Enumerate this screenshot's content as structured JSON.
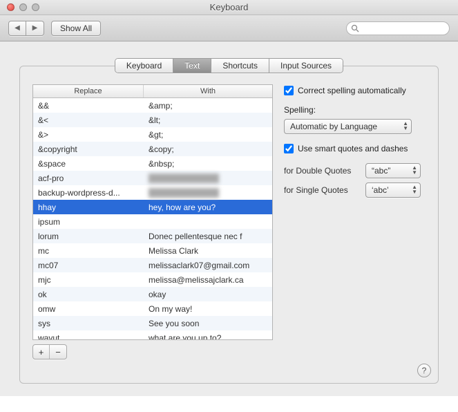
{
  "window": {
    "title": "Keyboard"
  },
  "toolbar": {
    "show_all": "Show All",
    "search_placeholder": ""
  },
  "tabs": {
    "items": [
      "Keyboard",
      "Text",
      "Shortcuts",
      "Input Sources"
    ],
    "active_index": 1
  },
  "table": {
    "header_replace": "Replace",
    "header_with": "With",
    "rows": [
      {
        "replace": "&&",
        "with": "&amp;"
      },
      {
        "replace": "&<",
        "with": "&lt;"
      },
      {
        "replace": "&>",
        "with": "&gt;"
      },
      {
        "replace": "&copyright",
        "with": "&copy;"
      },
      {
        "replace": "&space",
        "with": "&nbsp;"
      },
      {
        "replace": "acf-pro",
        "with": "████████████",
        "blurred": true
      },
      {
        "replace": "backup-wordpress-d...",
        "with": "████████████",
        "blurred": true
      },
      {
        "replace": "hhay",
        "with": "hey, how are you?",
        "selected": true
      },
      {
        "replace": "ipsum",
        "with": ""
      },
      {
        "replace": "lorum",
        "with": "Donec pellentesque nec f"
      },
      {
        "replace": "mc",
        "with": "Melissa Clark"
      },
      {
        "replace": "mc07",
        "with": "melissaclark07@gmail.com"
      },
      {
        "replace": "mjc",
        "with": "melissa@melissajclark.ca"
      },
      {
        "replace": "ok",
        "with": "okay"
      },
      {
        "replace": "omw",
        "with": "On my way!"
      },
      {
        "replace": "sys",
        "with": "See you soon"
      },
      {
        "replace": "wavut",
        "with": "what are you up to?"
      }
    ]
  },
  "options": {
    "correct_spelling": {
      "label": "Correct spelling automatically",
      "checked": true
    },
    "spelling_label": "Spelling:",
    "spelling_value": "Automatic by Language",
    "smart_quotes": {
      "label": "Use smart quotes and dashes",
      "checked": true
    },
    "double_quotes_label": "for Double Quotes",
    "double_quotes_value": "“abc”",
    "single_quotes_label": "for Single Quotes",
    "single_quotes_value": "‘abc’"
  },
  "buttons": {
    "add": "+",
    "remove": "−",
    "help": "?"
  }
}
